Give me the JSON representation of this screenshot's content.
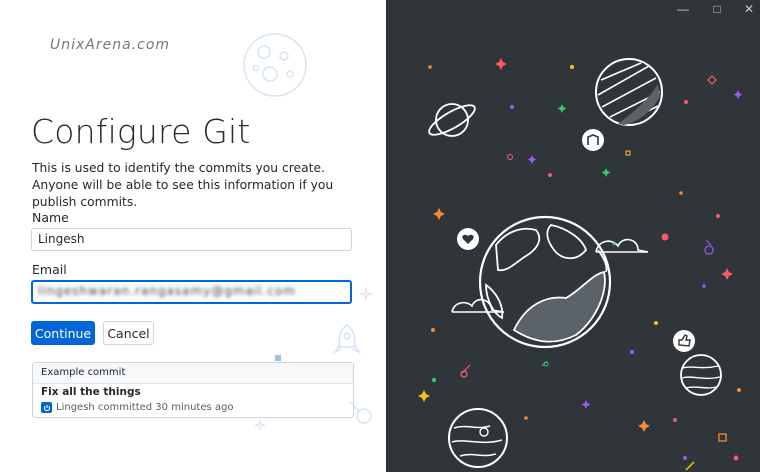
{
  "watermark": "UnixArena.com",
  "page_title": "Configure Git",
  "description": "This is used to identify the commits you create. Anyone will be able to see this information if you publish commits.",
  "name_field": {
    "label": "Name",
    "value": "Lingesh"
  },
  "email_field": {
    "label": "Email",
    "value": "lingeshwaran.rangasamy@gmail.com"
  },
  "buttons": {
    "continue": "Continue",
    "cancel": "Cancel"
  },
  "example_commit": {
    "header": "Example commit",
    "summary": "Fix all the things",
    "meta": "Lingesh committed 30 minutes ago"
  },
  "window_controls": {
    "minimize": "—",
    "maximize": "□",
    "close": "✕"
  },
  "colors": {
    "accent": "#0366d6",
    "illustration_bg": "#2f3539",
    "line_art": "#ffffff"
  }
}
